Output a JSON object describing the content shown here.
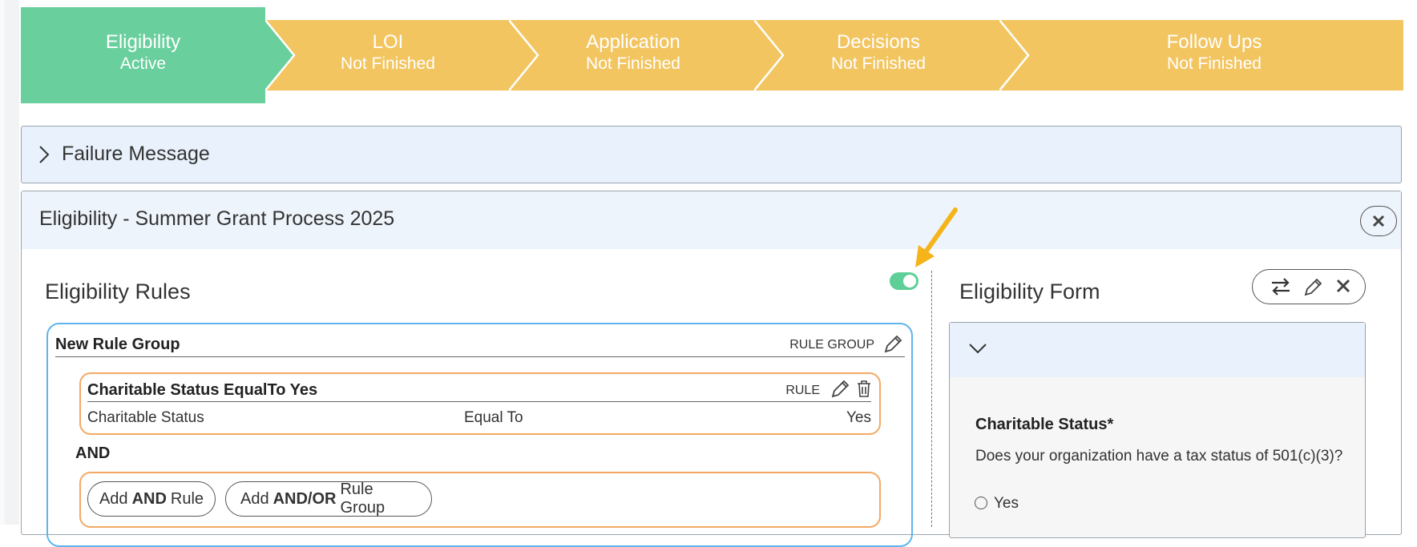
{
  "stepper": {
    "steps": [
      {
        "name": "Eligibility",
        "status": "Active",
        "color": "#68cf9d"
      },
      {
        "name": "LOI",
        "status": "Not Finished",
        "color": "#f2c561"
      },
      {
        "name": "Application",
        "status": "Not Finished",
        "color": "#f2c561"
      },
      {
        "name": "Decisions",
        "status": "Not Finished",
        "color": "#f2c561"
      },
      {
        "name": "Follow Ups",
        "status": "Not Finished",
        "color": "#f2c561"
      }
    ]
  },
  "failure_panel": {
    "label": "Failure Message",
    "icon": "chevron-right-icon"
  },
  "main_panel": {
    "title": "Eligibility - Summer Grant Process 2025",
    "close_icon": "close-icon"
  },
  "rules": {
    "title": "Eligibility Rules",
    "toggle_on": true,
    "rule_group": {
      "name": "New Rule Group",
      "tag": "RULE GROUP",
      "rule": {
        "name": "Charitable Status EqualTo Yes",
        "tag": "RULE",
        "field": "Charitable Status",
        "operator": "Equal To",
        "value": "Yes"
      },
      "connector": "AND",
      "add_rule": {
        "prefix": "Add",
        "bold": "AND",
        "suffix": "Rule"
      },
      "add_group": {
        "prefix": "Add",
        "bold": "AND/OR",
        "suffix": "Rule Group"
      }
    }
  },
  "form": {
    "title": "Eligibility Form",
    "toolbar_icons": [
      "swap-icon",
      "pencil-icon",
      "close-icon"
    ],
    "question": {
      "title": "Charitable Status*",
      "text": "Does your organization have a tax status of 501(c)(3)?",
      "options": [
        "Yes"
      ]
    }
  },
  "colors": {
    "active_step": "#68cf9d",
    "pending_step": "#f2c561",
    "rule_group_border": "#5eb4ec",
    "rule_border": "#f3a964",
    "annotation_arrow": "#f5b41a"
  }
}
